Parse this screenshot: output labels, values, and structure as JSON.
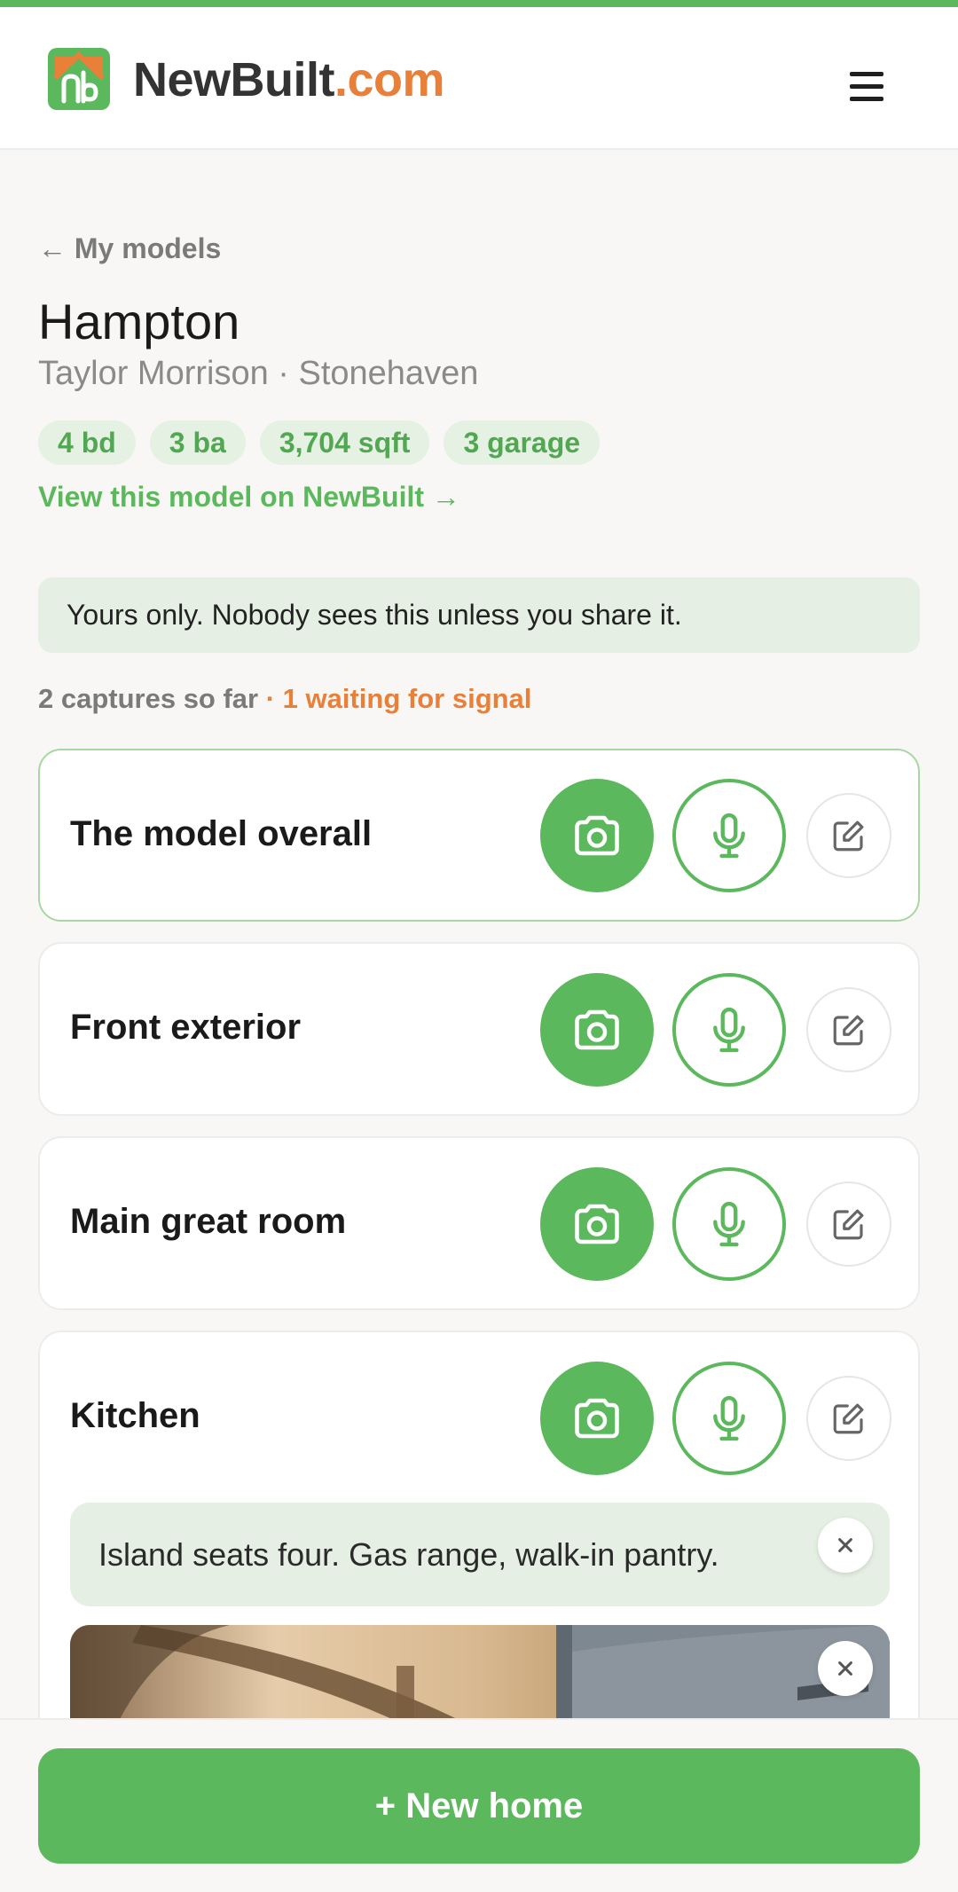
{
  "header": {
    "brand_name": "NewBuilt",
    "brand_tld": ".com",
    "menu_icon": "hamburger-menu-icon"
  },
  "nav": {
    "back_label": "← My models"
  },
  "model": {
    "title": "Hampton",
    "subtitle": "Taylor Morrison · Stonehaven",
    "chips": [
      "4 bd",
      "3 ba",
      "3,704 sqft",
      "3 garage"
    ],
    "view_link": "View this model on NewBuilt →"
  },
  "notice": "Yours only. Nobody sees this unless you share it.",
  "captures": {
    "count_text": "2 captures so far",
    "waiting_text": " · 1 waiting for signal"
  },
  "cards": [
    {
      "label": "The model overall"
    },
    {
      "label": "Front exterior"
    },
    {
      "label": "Main great room"
    },
    {
      "label": "Kitchen",
      "note": "Island seats four. Gas range, walk-in pantry."
    }
  ],
  "footer": {
    "new_home_label": "+ New home"
  },
  "colors": {
    "accent_green": "#5cb85c",
    "accent_orange": "#e8803a",
    "chip_bg": "#e5f1e3"
  }
}
